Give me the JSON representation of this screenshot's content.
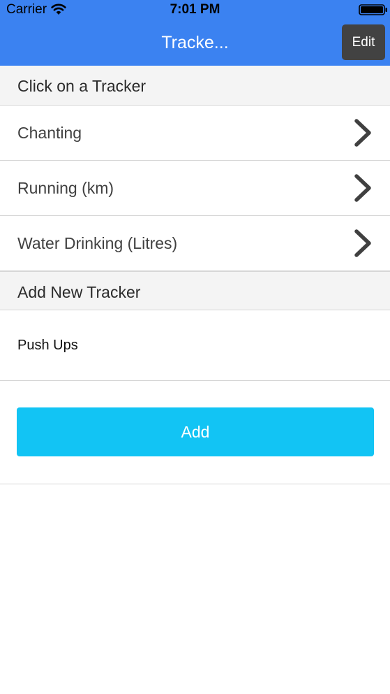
{
  "status_bar": {
    "carrier": "Carrier",
    "time": "7:01 PM",
    "icons": [
      "wifi-icon",
      "battery-icon"
    ]
  },
  "nav": {
    "title": "Tracke...",
    "edit_label": "Edit"
  },
  "trackers_section": {
    "header": "Click on a Tracker",
    "items": [
      {
        "label": "Chanting",
        "icon": "chevron-right-icon"
      },
      {
        "label": "Running (km)",
        "icon": "chevron-right-icon"
      },
      {
        "label": "Water Drinking (Litres)",
        "icon": "chevron-right-icon"
      }
    ]
  },
  "add_section": {
    "header": "Add New Tracker",
    "input_value": "Push Ups",
    "add_label": "Add"
  },
  "colors": {
    "nav_background": "#3b82f1",
    "edit_button": "#424242",
    "add_button": "#12c4f4",
    "section_header_background": "#f4f4f4"
  }
}
